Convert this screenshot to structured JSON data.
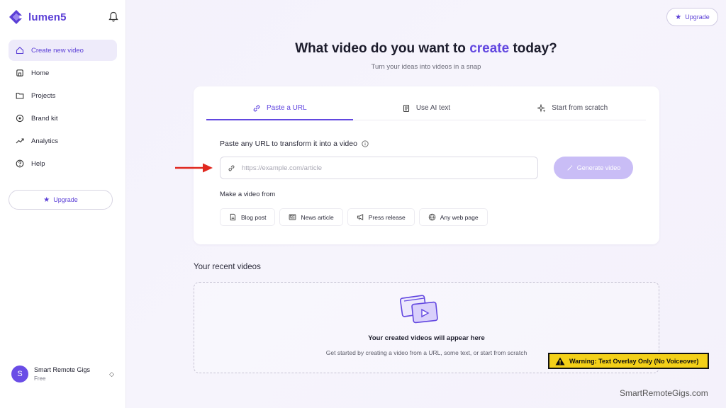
{
  "app": {
    "brand": "lumen5"
  },
  "sidebar": {
    "items": [
      {
        "label": "Create new video",
        "icon": "home-icon"
      },
      {
        "label": "Home",
        "icon": "house-icon"
      },
      {
        "label": "Projects",
        "icon": "folder-icon"
      },
      {
        "label": "Brand kit",
        "icon": "palette-icon"
      },
      {
        "label": "Analytics",
        "icon": "trend-icon"
      },
      {
        "label": "Help",
        "icon": "help-icon"
      }
    ],
    "upgrade_label": "Upgrade",
    "user": {
      "initial": "S",
      "name": "Smart Remote Gigs",
      "plan": "Free"
    }
  },
  "header": {
    "upgrade_label": "Upgrade"
  },
  "hero": {
    "title_before": "What video do you want to ",
    "title_accent": "create",
    "title_after": " today?",
    "subtitle": "Turn your ideas into videos in a snap"
  },
  "tabs": [
    {
      "label": "Paste a URL",
      "icon": "link-icon",
      "active": true
    },
    {
      "label": "Use AI text",
      "icon": "document-icon",
      "active": false
    },
    {
      "label": "Start from scratch",
      "icon": "sparkle-icon",
      "active": false
    }
  ],
  "url_form": {
    "label": "Paste any URL to transform it into a video",
    "placeholder": "https://example.com/article",
    "value": "",
    "generate_label": "Generate video",
    "make_from_label": "Make a video from",
    "chips": [
      "Blog post",
      "News article",
      "Press release",
      "Any web page"
    ]
  },
  "recent": {
    "title": "Your recent videos",
    "empty_title": "Your created videos will appear here",
    "empty_subtitle": "Get started by creating a video from a URL, some text, or start from scratch"
  },
  "overlay": {
    "warning": "Warning: Text Overlay Only (No Voiceover)",
    "watermark": "SmartRemoteGigs.com"
  },
  "colors": {
    "accent": "#6247e0",
    "generate_disabled": "#c9bdf6",
    "warning_bg": "#f3d018",
    "arrow": "#e0281f"
  }
}
